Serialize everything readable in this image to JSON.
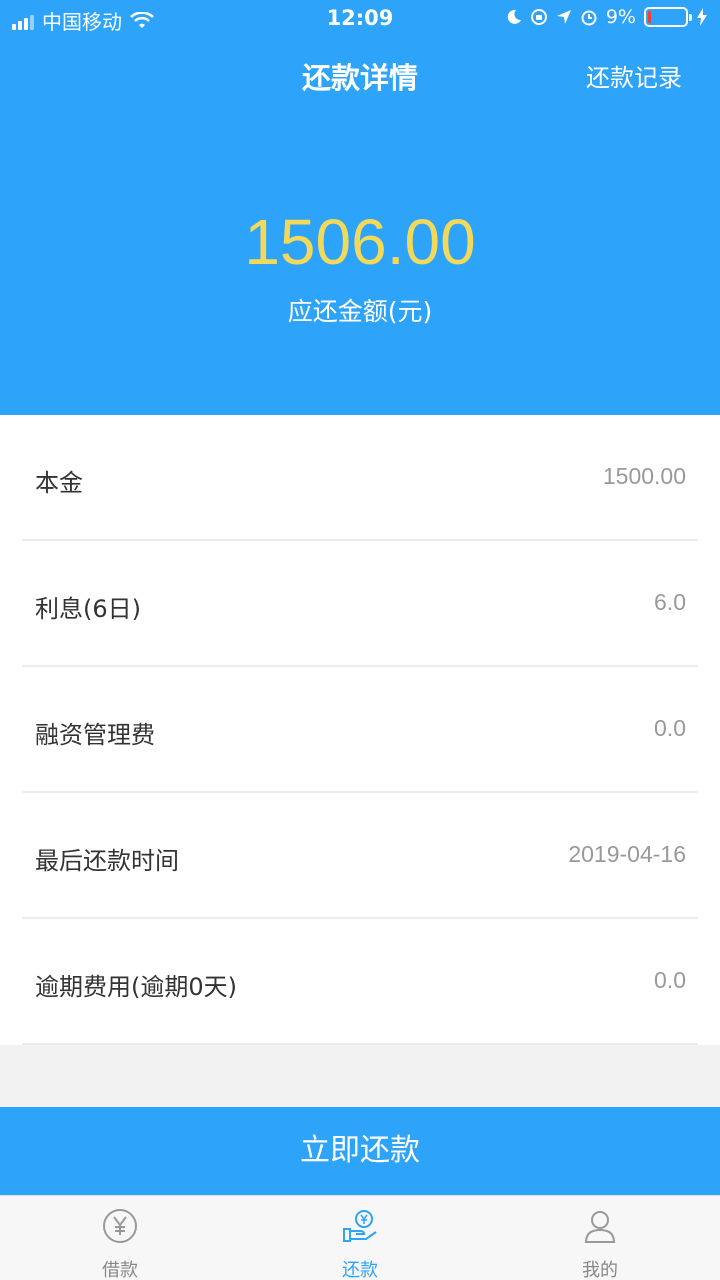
{
  "status_bar": {
    "carrier": "中国移动",
    "time": "12:09",
    "battery": "9%",
    "battery_level": 0.09
  },
  "header": {
    "title": "还款详情",
    "records_link": "还款记录"
  },
  "summary": {
    "amount": "1506.00",
    "amount_label": "应还金额(元)"
  },
  "details": [
    {
      "label": "本金",
      "value": "1500.00"
    },
    {
      "label": "利息(6日)",
      "value": "6.0"
    },
    {
      "label": "融资管理费",
      "value": "0.0"
    },
    {
      "label": "最后还款时间",
      "value": "2019-04-16"
    },
    {
      "label": "逾期费用(逾期0天)",
      "value": "0.0"
    }
  ],
  "pay_button": "立即还款",
  "tabs": [
    {
      "label": "借款",
      "icon": "yen-coin-icon",
      "active": false
    },
    {
      "label": "还款",
      "icon": "repay-hand-icon",
      "active": true
    },
    {
      "label": "我的",
      "icon": "user-icon",
      "active": false
    }
  ],
  "colors": {
    "primary": "#2ea3fa",
    "amount": "#f2d95a"
  }
}
